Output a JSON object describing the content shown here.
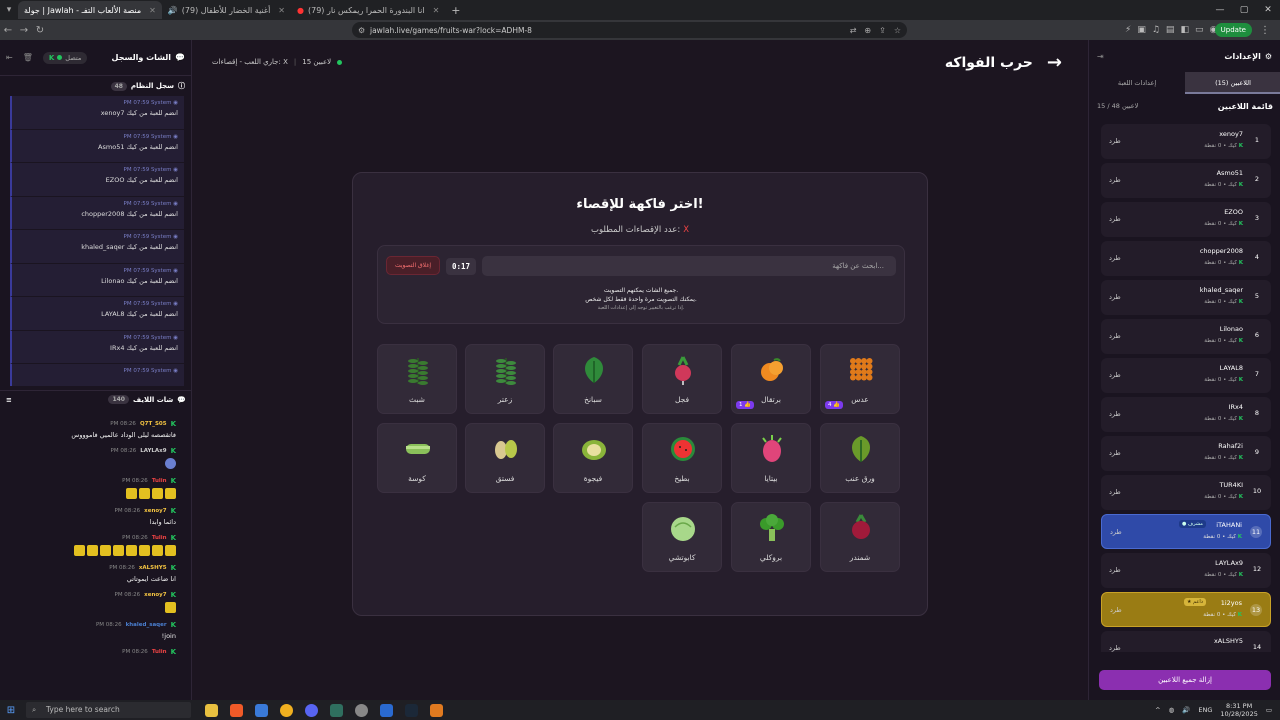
{
  "browser": {
    "tabs": [
      {
        "label": "جولة | Jawlah - منصة الألعاب التفـ",
        "active": true
      },
      {
        "label": "(79) أغنية الخضار للأطفال",
        "active": false
      },
      {
        "label": "(79) انا البندورة الحمرا ريمكس نار",
        "active": false
      }
    ],
    "url": "jawlah.live/games/fruits-war?lock=ADHM-8",
    "update_label": "Update"
  },
  "left": {
    "title": "الشات والسجل",
    "connection": "متصل",
    "syslog_title": "سجل النظام",
    "syslog_count": "48",
    "syslog": [
      {
        "who": "System",
        "time": "PM 07:59",
        "text": "xenoy7 انضم للعبة من كيك"
      },
      {
        "who": "System",
        "time": "PM 07:59",
        "text": "Asmo51 انضم للعبة من كيك"
      },
      {
        "who": "System",
        "time": "PM 07:59",
        "text": "EZOO انضم للعبة من كيك"
      },
      {
        "who": "System",
        "time": "PM 07:59",
        "text": "chopper2008 انضم للعبة من كيك"
      },
      {
        "who": "System",
        "time": "PM 07:59",
        "text": "khaled_saqer انضم للعبة من كيك"
      },
      {
        "who": "System",
        "time": "PM 07:59",
        "text": "Lilonao انضم للعبة من كيك"
      },
      {
        "who": "System",
        "time": "PM 07:59",
        "text": "LAYAL8 انضم للعبة من كيك"
      },
      {
        "who": "System",
        "time": "PM 07:59",
        "text": "IRx4 انضم للعبة من كيك"
      },
      {
        "who": "System",
        "time": "PM 07:59",
        "text": ""
      }
    ],
    "live_title": "شات اللايف",
    "live_count": "140",
    "messages": [
      {
        "user": "Q7T_S05",
        "time": "PM 08:26",
        "text": "فاتقصصه ليلى الوداد عالميي فاموووس",
        "color": "#f5c542",
        "emojis": 0,
        "blue": false
      },
      {
        "user": "LAYLAx9",
        "time": "PM 08:26",
        "text": "",
        "color": "#cccccc",
        "emojis": 0,
        "blue": true
      },
      {
        "user": "Tulin",
        "time": "PM 08:26",
        "text": "",
        "color": "#ef4444",
        "emojis": 4,
        "blue": false
      },
      {
        "user": "xenoy7",
        "time": "PM 08:26",
        "text": "دائما وابدا",
        "color": "#f5c542",
        "emojis": 0,
        "blue": false
      },
      {
        "user": "Tulin",
        "time": "PM 08:26",
        "text": "",
        "color": "#ef4444",
        "emojis": 8,
        "blue": false
      },
      {
        "user": "xALSHY5",
        "time": "PM 08:26",
        "text": "انا ضاعت ايموتاتي",
        "color": "#f5c542",
        "emojis": 0,
        "blue": false
      },
      {
        "user": "xenoy7",
        "time": "PM 08:26",
        "text": "",
        "color": "#f5c542",
        "emojis": 1,
        "blue": false
      },
      {
        "user": "khaled_saqer",
        "time": "PM 08:26",
        "text": "!join",
        "color": "#4a7fd0",
        "emojis": 0,
        "blue": false
      },
      {
        "user": "Tulin",
        "time": "PM 08:26",
        "text": "",
        "color": "#ef4444",
        "emojis": 0,
        "blue": false
      }
    ]
  },
  "center": {
    "status": "جاري اللعب - إقصاءات: X",
    "players_count": "15 لاعبين",
    "page_title": "حرب الفواكه",
    "card_title": "اختر فاكهة للإقصاء!",
    "card_sub": "عدد الإقصاءات المطلوب:",
    "card_sub_x": "X",
    "search_placeholder": "ابحث عن فاكهة...",
    "timer": "0:17",
    "close_vote": "إغلاق التصويت",
    "info1": "جميع الشات يمكنهم التصويت.",
    "info2": "يمكنك التصويت مرة واحدة فقط لكل شخص.",
    "info3": "إذا ترغب بالتغيير توجه إلى إعدادات اللعبة.",
    "fruits": [
      {
        "name": "عدس",
        "color": "#e07a1a",
        "kind": "lentil",
        "votes": "4"
      },
      {
        "name": "برتقال",
        "color": "#f08a20",
        "kind": "orange",
        "votes": "1"
      },
      {
        "name": "فجل",
        "color": "#d0385a",
        "kind": "radish",
        "votes": ""
      },
      {
        "name": "سبانخ",
        "color": "#2f8a3a",
        "kind": "leaf",
        "votes": ""
      },
      {
        "name": "زعتر",
        "color": "#3d8a3d",
        "kind": "herb",
        "votes": ""
      },
      {
        "name": "شبث",
        "color": "#3a7a30",
        "kind": "herb",
        "votes": ""
      },
      {
        "name": "ورق عنب",
        "color": "#6a9a2a",
        "kind": "leaf",
        "votes": ""
      },
      {
        "name": "بيتايا",
        "color": "#e0457a",
        "kind": "dragon",
        "votes": ""
      },
      {
        "name": "بطيخ",
        "color": "#2a8a3a",
        "kind": "watermelon",
        "votes": ""
      },
      {
        "name": "فيجوة",
        "color": "#8ab43a",
        "kind": "feijoa",
        "votes": ""
      },
      {
        "name": "فستق",
        "color": "#b8c84a",
        "kind": "pistachio",
        "votes": ""
      },
      {
        "name": "كوسة",
        "color": "#8ac05a",
        "kind": "zucchini",
        "votes": ""
      },
      {
        "name": "شمندر",
        "color": "#a01a3a",
        "kind": "beet",
        "votes": ""
      },
      {
        "name": "بروكلي",
        "color": "#3a9a2a",
        "kind": "broccoli",
        "votes": ""
      },
      {
        "name": "كابوتشي",
        "color": "#a8d88a",
        "kind": "cabbage",
        "votes": ""
      }
    ]
  },
  "right": {
    "title": "الإعدادات",
    "tab_players": "اللاعبين (15)",
    "tab_settings": "إعدادات اللعبة",
    "list_title": "قائمة اللاعبين",
    "list_count": "15 / 48 لاعبين",
    "kick_label": "طرد",
    "players": [
      {
        "n": "1",
        "name": "xenoy7",
        "stat": "كيك • 0 نقطة",
        "tag": "",
        "style": ""
      },
      {
        "n": "2",
        "name": "Asmo51",
        "stat": "كيك • 0 نقطة",
        "tag": "",
        "style": ""
      },
      {
        "n": "3",
        "name": "EZOO",
        "stat": "كيك • 0 نقطة",
        "tag": "",
        "style": ""
      },
      {
        "n": "4",
        "name": "chopper2008",
        "stat": "كيك • 0 نقطة",
        "tag": "",
        "style": ""
      },
      {
        "n": "5",
        "name": "khaled_saqer",
        "stat": "كيك • 0 نقطة",
        "tag": "",
        "style": ""
      },
      {
        "n": "6",
        "name": "Lilonao",
        "stat": "كيك • 0 نقطة",
        "tag": "",
        "style": ""
      },
      {
        "n": "7",
        "name": "LAYAL8",
        "stat": "كيك • 0 نقطة",
        "tag": "",
        "style": ""
      },
      {
        "n": "8",
        "name": "IRx4",
        "stat": "كيك • 0 نقطة",
        "tag": "",
        "style": ""
      },
      {
        "n": "9",
        "name": "Rahaf2i",
        "stat": "كيك • 0 نقطة",
        "tag": "",
        "style": ""
      },
      {
        "n": "10",
        "name": "TUR4KI",
        "stat": "كيك • 0 نقطة",
        "tag": "",
        "style": ""
      },
      {
        "n": "11",
        "name": "iTAHANi",
        "stat": "كيك • 0 نقطة",
        "tag": "● مشرف",
        "style": "blue"
      },
      {
        "n": "12",
        "name": "LAYLAx9",
        "stat": "كيك • 0 نقطة",
        "tag": "",
        "style": ""
      },
      {
        "n": "13",
        "name": "1i2yos",
        "stat": "كيك • 0 نقطة",
        "tag": "★ داعم",
        "style": "gold"
      },
      {
        "n": "14",
        "name": "xALSHY5",
        "stat": "",
        "tag": "",
        "style": ""
      }
    ],
    "remove_all": "إزالة جميع اللاعبين"
  },
  "taskbar": {
    "search": "Type here to search",
    "lang": "ENG",
    "time": "8:31 PM",
    "date": "10/28/2025"
  }
}
